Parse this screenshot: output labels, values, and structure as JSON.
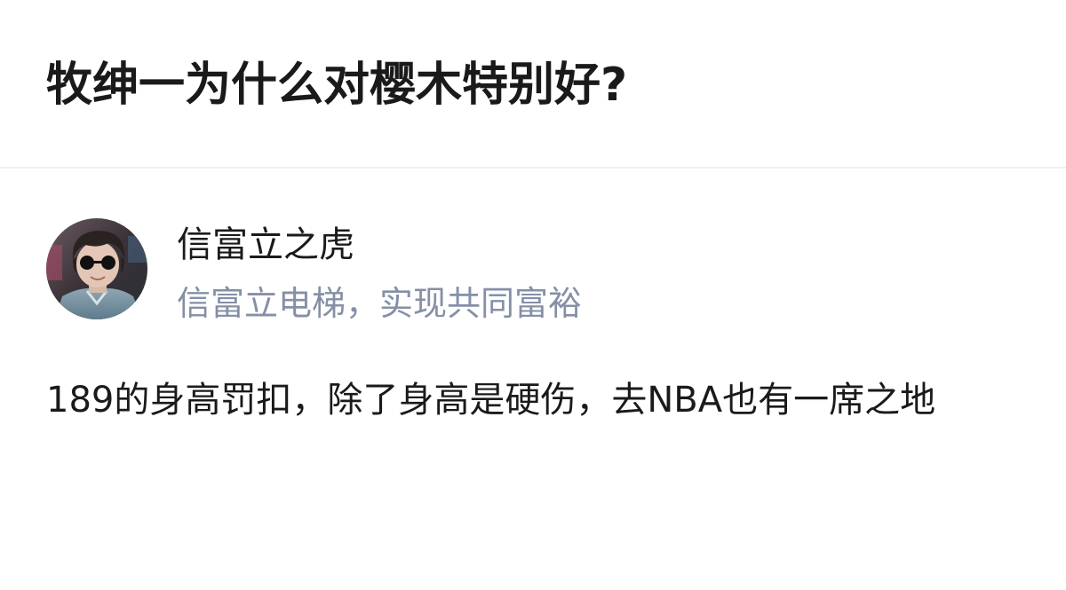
{
  "question": {
    "title": "牧绅一为什么对樱木特别好?"
  },
  "answer": {
    "author": {
      "name": "信富立之虎",
      "headline": "信富立电梯，实现共同富裕",
      "avatar_icon": "user-avatar-photo"
    },
    "content": "189的身高罚扣，除了身高是硬伤，去NBA也有一席之地"
  },
  "colors": {
    "title_text": "#1a1a1a",
    "headline_text": "#8590a6",
    "divider": "#f0f0f2",
    "background": "#ffffff"
  }
}
